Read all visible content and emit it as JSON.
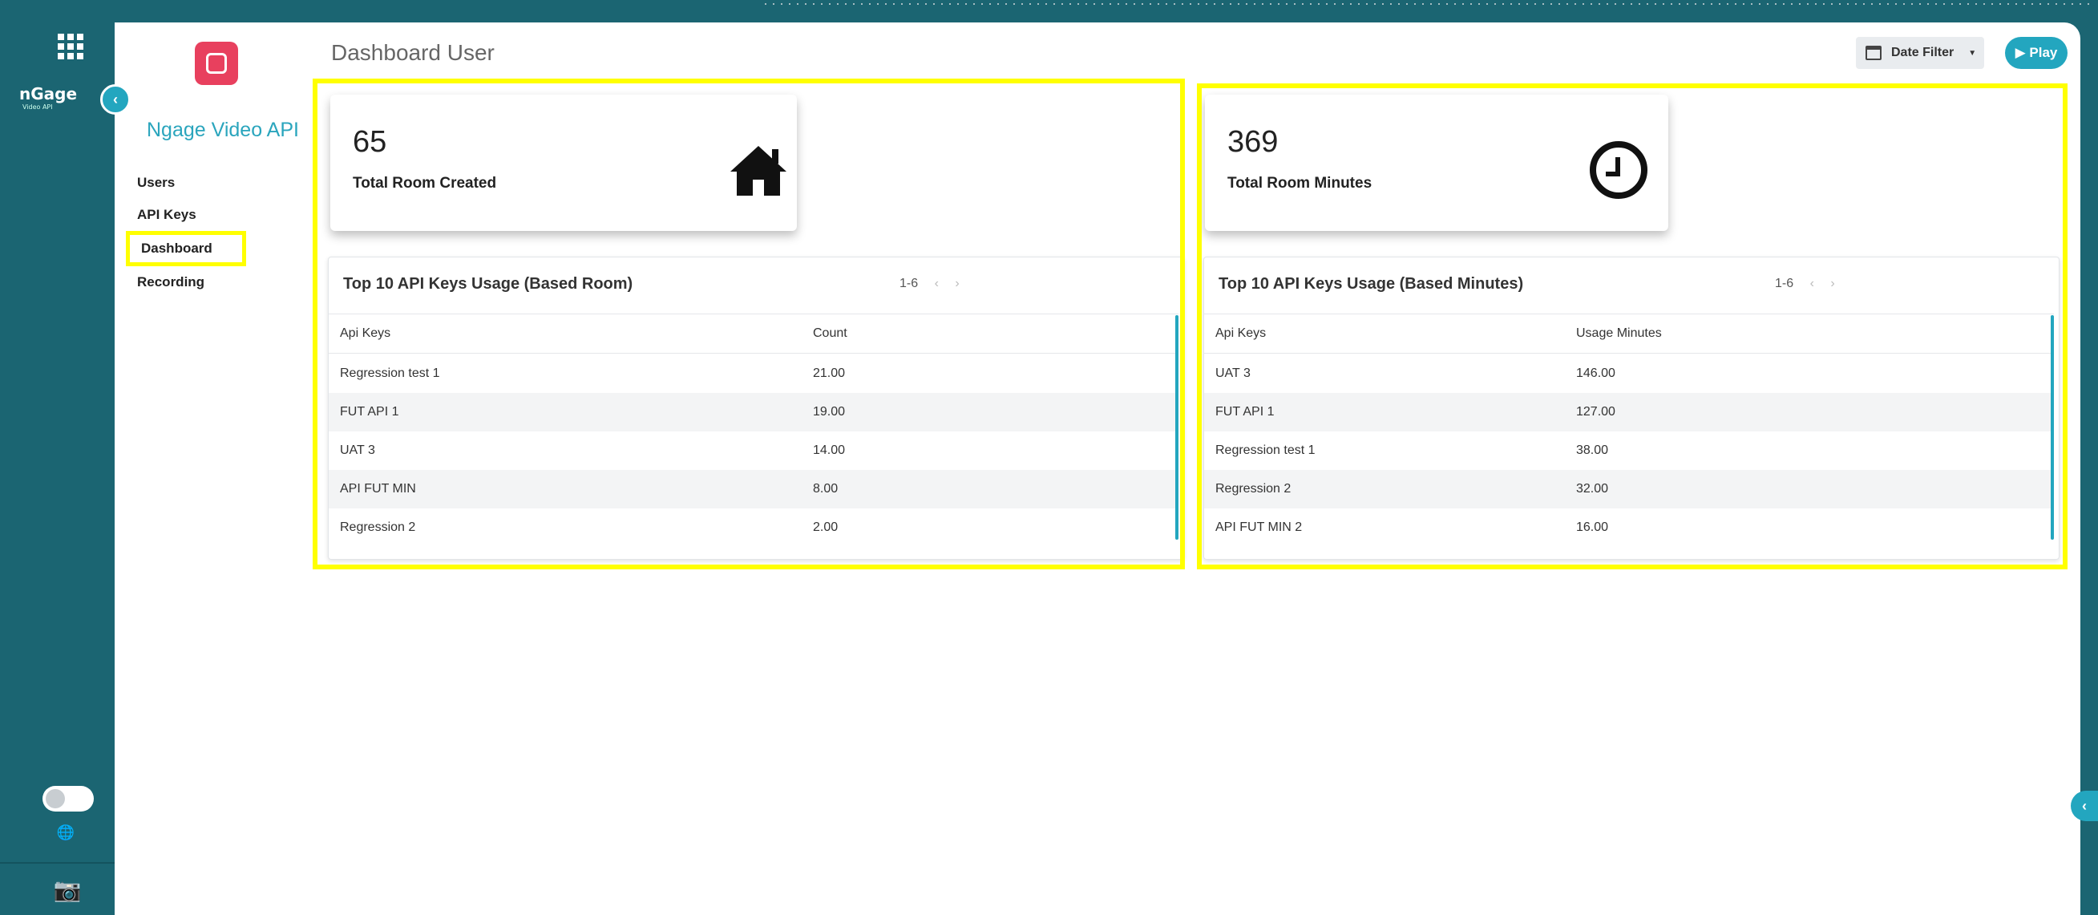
{
  "app": {
    "brand": "nGage",
    "brand_sub": "Video API",
    "product_title": "Ngage Video API"
  },
  "sidebar": {
    "items": [
      {
        "label": "Users"
      },
      {
        "label": "API Keys"
      },
      {
        "label": "Dashboard",
        "active": true
      },
      {
        "label": "Recording"
      }
    ]
  },
  "header": {
    "title": "Dashboard User",
    "date_filter_label": "Date Filter",
    "play_label": "▶ Play"
  },
  "stats": {
    "rooms": {
      "value": "65",
      "label": "Total Room Created",
      "icon": "house-icon"
    },
    "minutes": {
      "value": "369",
      "label": "Total Room Minutes",
      "icon": "clock-icon"
    }
  },
  "tables": {
    "by_room": {
      "title": "Top 10 API Keys Usage (Based Room)",
      "pager": "1-6",
      "columns": [
        "Api Keys",
        "Count"
      ],
      "rows": [
        [
          "Regression test 1",
          "21.00"
        ],
        [
          "FUT API 1",
          "19.00"
        ],
        [
          "UAT 3",
          "14.00"
        ],
        [
          "API FUT MIN",
          "8.00"
        ],
        [
          "Regression 2",
          "2.00"
        ]
      ]
    },
    "by_minutes": {
      "title": "Top 10 API Keys Usage (Based Minutes)",
      "pager": "1-6",
      "columns": [
        "Api Keys",
        "Usage Minutes"
      ],
      "rows": [
        [
          "UAT 3",
          "146.00"
        ],
        [
          "FUT API 1",
          "127.00"
        ],
        [
          "Regression test 1",
          "38.00"
        ],
        [
          "Regression 2",
          "32.00"
        ],
        [
          "API FUT MIN 2",
          "16.00"
        ]
      ]
    }
  },
  "colors": {
    "rail": "#1b6572",
    "accent": "#23a6bf",
    "highlight": "#ffff00",
    "logo": "#e8405e"
  }
}
